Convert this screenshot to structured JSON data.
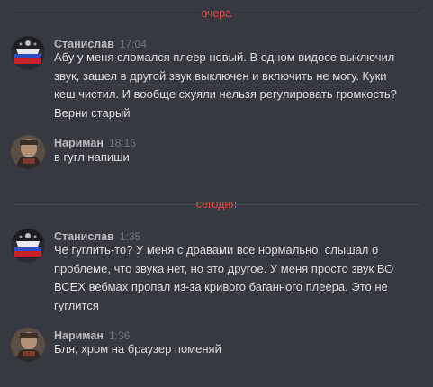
{
  "dividers": {
    "yesterday": "вчера",
    "today": "сегодня"
  },
  "messages": [
    {
      "author": "Станислав",
      "time": "17:04",
      "avatar": "avatar-stanislav",
      "lines": [
        "Абу у меня сломался плеер новый. В одном видосе выключил",
        "звук, зашел в другой звук выключен и включить не могу. Куки",
        "кеш чистил. И вообще схуяли нельзя регулировать громкость?",
        "Верни старый"
      ]
    },
    {
      "author": "Нариман",
      "time": "18:16",
      "avatar": "avatar-nariman",
      "lines": [
        "в гугл напиши"
      ]
    },
    {
      "author": "Станислав",
      "time": "1:35",
      "avatar": "avatar-stanislav",
      "lines": [
        "Че гуглить-то? У меня с дравами все нормально, слышал о",
        "проблеме, что звука нет, но это другое. У меня просто звук ВО",
        "ВСЕХ вебмах пропал из-за кривого баганного плеера. Это не",
        "гуглится"
      ]
    },
    {
      "author": "Нариман",
      "time": "1:36",
      "avatar": "avatar-nariman",
      "lines": [
        "Бля, хром на браузер поменяй"
      ]
    }
  ],
  "colors": {
    "background": "#36393f",
    "divider_text": "#f04747",
    "author": "#b9bbbe",
    "timestamp": "#72767d",
    "message_text": "#dcddde"
  }
}
